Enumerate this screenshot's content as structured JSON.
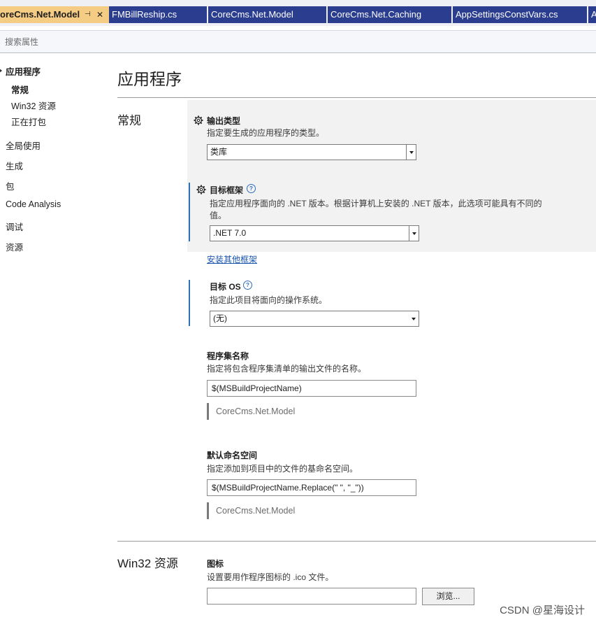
{
  "tabs": [
    {
      "label": "oreCms.Net.Model",
      "active": true
    },
    {
      "label": "FMBillReship.cs"
    },
    {
      "label": "CoreCms.Net.Model"
    },
    {
      "label": "CoreCms.Net.Caching"
    },
    {
      "label": "AppSettingsConstVars.cs"
    },
    {
      "label": "A"
    }
  ],
  "tab_icons": {
    "pin": "⊣",
    "close": "✕"
  },
  "search": {
    "placeholder": "搜索属性"
  },
  "nav": {
    "items": [
      {
        "label": "应用程序"
      },
      {
        "label": "常规"
      },
      {
        "label": "Win32 资源"
      },
      {
        "label": "正在打包"
      },
      {
        "label": "全局使用"
      },
      {
        "label": "生成"
      },
      {
        "label": "包"
      },
      {
        "label": "Code Analysis"
      },
      {
        "label": "调试"
      },
      {
        "label": "资源"
      }
    ]
  },
  "page": {
    "title": "应用程序"
  },
  "general": {
    "section_title": "常规",
    "output_type": {
      "title": "输出类型",
      "desc": "指定要生成的应用程序的类型。",
      "value": "类库"
    },
    "target_framework": {
      "title": "目标框架",
      "help": "?",
      "desc1": "指定应用程序面向的 .NET 版本。根据计算机上安装的 .NET 版本，此选项可能具有不同的",
      "desc2": "值。",
      "value": ".NET 7.0",
      "link": "安装其他框架"
    },
    "target_os": {
      "title": "目标 OS",
      "help": "?",
      "desc": "指定此项目将面向的操作系统。",
      "value": "(无)"
    },
    "assembly_name": {
      "title": "程序集名称",
      "desc": "指定将包含程序集清单的输出文件的名称。",
      "value": "$(MSBuildProjectName)",
      "preview": "CoreCms.Net.Model"
    },
    "root_namespace": {
      "title": "默认命名空间",
      "desc": "指定添加到项目中的文件的基命名空间。",
      "value": "$(MSBuildProjectName.Replace(\" \", \"_\"))",
      "preview": "CoreCms.Net.Model"
    }
  },
  "win32": {
    "section_title": "Win32 资源",
    "icon": {
      "title": "图标",
      "desc": "设置要用作程序图标的 .ico 文件。",
      "value": "",
      "browse": "浏览..."
    }
  },
  "watermark": "CSDN @星海设计",
  "colors": {
    "tab_active": "#f5cc84",
    "tab_inactive": "#2b3d8f",
    "accent": "#2f6fb5",
    "link": "#1a56b0"
  }
}
